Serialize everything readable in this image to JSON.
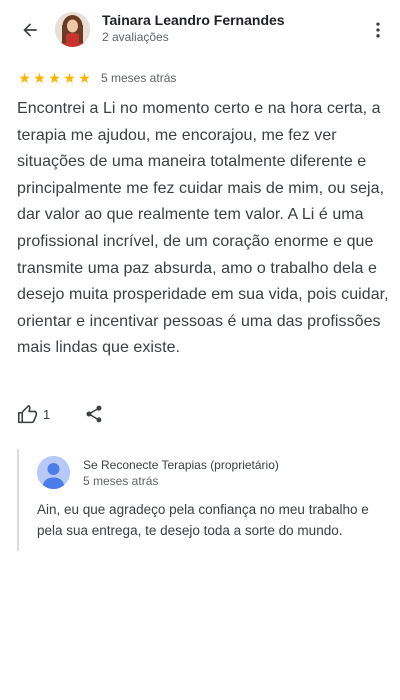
{
  "header": {
    "back_icon": "arrow-back-icon",
    "reviewer_name": "Tainara Leandro Fernandes",
    "review_count": "2 avaliações",
    "more_icon": "more-vert-icon"
  },
  "review": {
    "rating": 5,
    "rating_max": 5,
    "star_color": "#f4b400",
    "date": "5 meses atrás",
    "text": "Encontrei a Li no momento certo e na hora certa, a terapia me ajudou, me encorajou, me fez ver situações de uma maneira totalmente diferente e principalmente me fez cuidar mais de mim, ou seja, dar valor ao que realmente tem valor. A Li é uma profissional incrível, de um coração enorme e que transmite uma paz absurda, amo o trabalho dela e desejo muita prosperidade em sua vida, pois cuidar, orientar e incentivar pessoas é uma das profissões mais lindas que existe."
  },
  "actions": {
    "like_icon": "thumb-up-icon",
    "like_count": "1",
    "share_icon": "share-icon"
  },
  "owner_reply": {
    "name": "Se Reconecte Terapias (proprietário)",
    "date": "5 meses atrás",
    "text": "Ain, eu que agradeço pela confiança no meu trabalho e pela sua entrega, te desejo toda a sorte do mundo.",
    "avatar_icon": "person-avatar-icon",
    "avatar_color": "#b7c9f6",
    "avatar_figure_color": "#4c7ce8"
  }
}
